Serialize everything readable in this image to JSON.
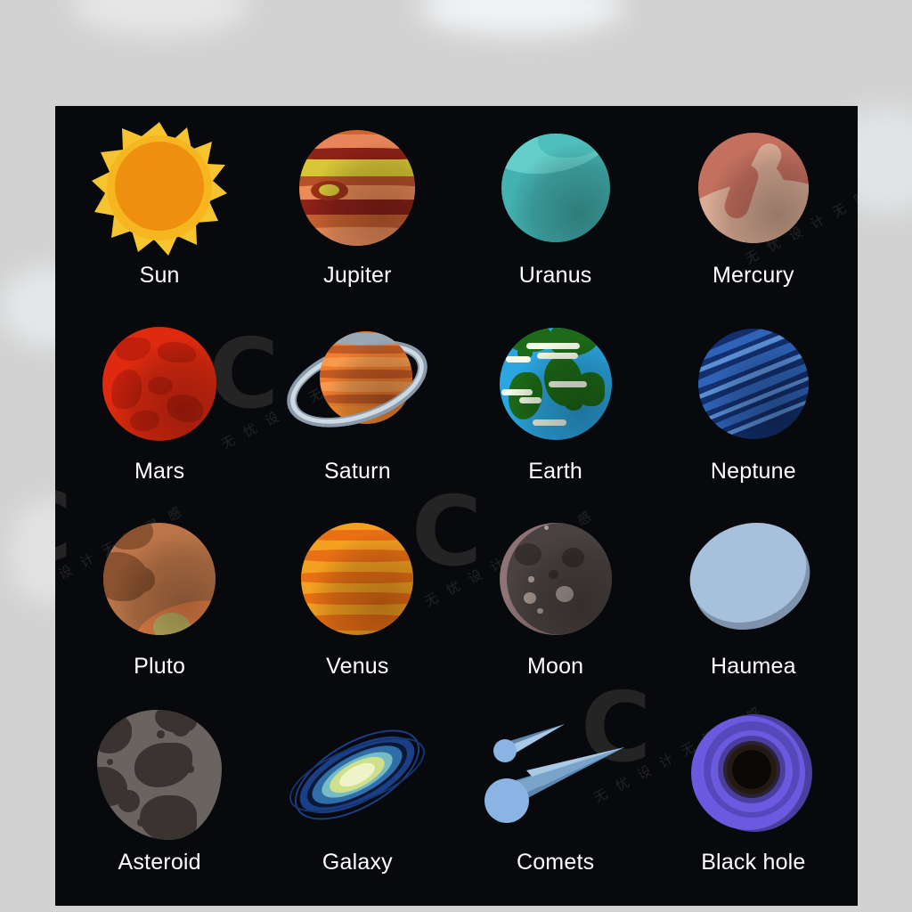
{
  "poster": {
    "background_color": "#07090d",
    "page_background_color": "#d2d2d2",
    "label_color": "#ffffff"
  },
  "watermark": {
    "logo_text": "C",
    "chinese_text": "无 忧 设 计  无 限 灵 感",
    "color": "#2b2b2b"
  },
  "items": [
    {
      "id": "sun",
      "label": "Sun",
      "icon": "sun-icon",
      "row": 1,
      "col": 1,
      "colors": {
        "corona": "#f6c431",
        "core_outer": "#f6b620",
        "core_inner": "#ef8f10"
      }
    },
    {
      "id": "jupiter",
      "label": "Jupiter",
      "icon": "jupiter-icon",
      "row": 1,
      "col": 2,
      "colors": {
        "base": "#d0642e",
        "dark_band": "#8e2118",
        "yellow_band": "#d8c637",
        "light_band": "#ec8b56",
        "spot": "#9c3218"
      }
    },
    {
      "id": "uranus",
      "label": "Uranus",
      "icon": "uranus-icon",
      "row": 1,
      "col": 3,
      "colors": {
        "base": "#43b2b0",
        "highlight": "#64cfca"
      }
    },
    {
      "id": "mercury",
      "label": "Mercury",
      "icon": "mercury-icon",
      "row": 1,
      "col": 4,
      "colors": {
        "base": "#c4705f",
        "light": "#d9ac95"
      }
    },
    {
      "id": "mars",
      "label": "Mars",
      "icon": "mars-icon",
      "row": 2,
      "col": 1,
      "colors": {
        "base": "#e02a10",
        "patch": "#c2200c"
      }
    },
    {
      "id": "saturn",
      "label": "Saturn",
      "icon": "saturn-icon",
      "row": 2,
      "col": 2,
      "colors": {
        "globe": "#ef7d2e",
        "band_dark": "#c25a23",
        "band_light": "#f79a4e",
        "ring_outer": "#8b9bab",
        "ring_inner": "#cfd9e2"
      }
    },
    {
      "id": "earth",
      "label": "Earth",
      "icon": "earth-icon",
      "row": 2,
      "col": 3,
      "colors": {
        "ocean": "#2ba6e0",
        "land": "#1d6b18",
        "cloud": "#f4fbe8"
      }
    },
    {
      "id": "neptune",
      "label": "Neptune",
      "icon": "neptune-icon",
      "row": 2,
      "col": 4,
      "colors": {
        "base": "#122f6e",
        "band": "#2f63b8",
        "band_light": "#5a8fd6"
      }
    },
    {
      "id": "pluto",
      "label": "Pluto",
      "icon": "pluto-icon",
      "row": 3,
      "col": 1,
      "colors": {
        "base": "#bb7548",
        "dark": "#8a522f",
        "orange": "#f0864a",
        "khaki": "#c6ba64"
      }
    },
    {
      "id": "venus",
      "label": "Venus",
      "icon": "venus-icon",
      "row": 3,
      "col": 2,
      "colors": {
        "base": "#f5a020",
        "band": "#e96f14"
      }
    },
    {
      "id": "moon",
      "label": "Moon",
      "icon": "moon-icon",
      "row": 3,
      "col": 3,
      "colors": {
        "base": "#4a4240",
        "rim": "#8d7375",
        "crater_dark": "#352f2e",
        "crater_light": "#ab9d96"
      }
    },
    {
      "id": "haumea",
      "label": "Haumea",
      "icon": "haumea-icon",
      "row": 3,
      "col": 4,
      "colors": {
        "front": "#a7c1dc",
        "back": "#7e93ab"
      }
    },
    {
      "id": "asteroid",
      "label": "Asteroid",
      "icon": "asteroid-icon",
      "row": 4,
      "col": 1,
      "colors": {
        "base": "#6b635f",
        "dark": "#3a3331"
      }
    },
    {
      "id": "galaxy",
      "label": "Galaxy",
      "icon": "galaxy-icon",
      "row": 4,
      "col": 2,
      "colors": {
        "outer": "#1b3f86",
        "mid": "#2f6ea8",
        "teal": "#77bcc4",
        "inner": "#cfe08a",
        "core": "#eef3c8"
      }
    },
    {
      "id": "comets",
      "label": "Comets",
      "icon": "comets-icon",
      "row": 4,
      "col": 3,
      "colors": {
        "head": "#8ab4e3",
        "tail": "#5b86ad",
        "tail_light": "#a9c9e4"
      }
    },
    {
      "id": "black-hole",
      "label": "Black hole",
      "icon": "black-hole-icon",
      "row": 4,
      "col": 4,
      "colors": {
        "outer": "#6b5ae0",
        "mid": "#5548ba",
        "inner": "#4a3f9e",
        "center": "#0b0906"
      }
    }
  ]
}
